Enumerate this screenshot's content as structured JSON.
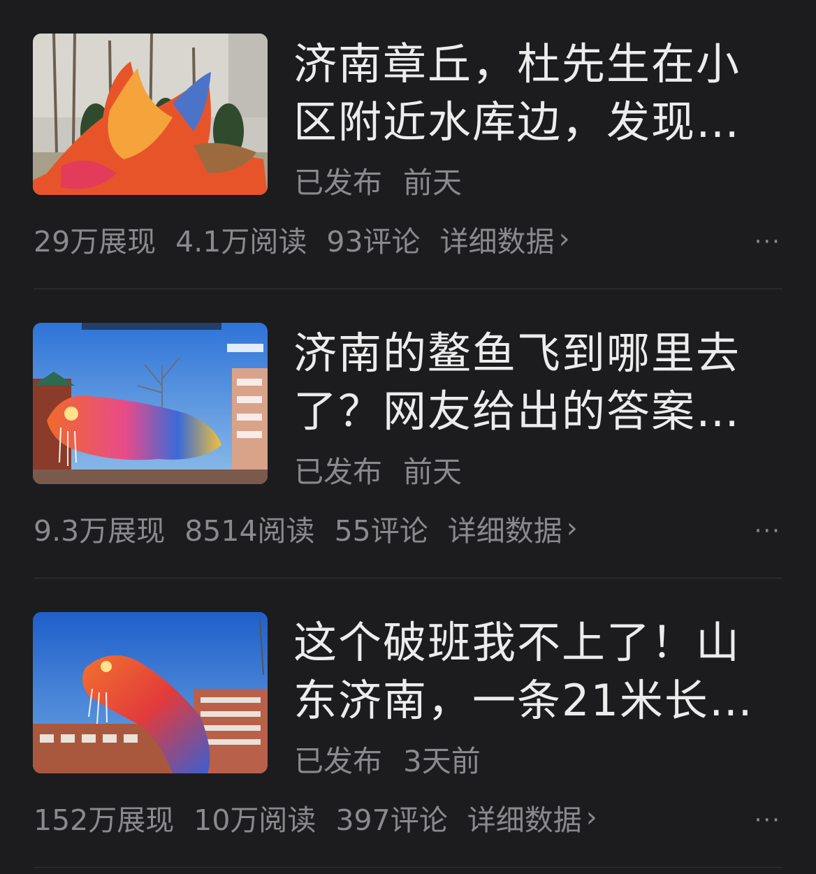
{
  "articles": [
    {
      "title_line1": "济南章丘，杜先生在小",
      "title_line2": "区附近水库边，发现…",
      "status": "已发布",
      "time": "前天",
      "impressions": "29万展现",
      "reads": "4.1万阅读",
      "comments": "93评论",
      "detail_label": "详细数据",
      "more_label": "···",
      "thumb_icon": "lantern-photo-thumbnail"
    },
    {
      "title_line1": "济南的鳌鱼飞到哪里去",
      "title_line2": "了？网友给出的答案…",
      "status": "已发布",
      "time": "前天",
      "impressions": "9.3万展现",
      "reads": "8514阅读",
      "comments": "55评论",
      "detail_label": "详细数据",
      "more_label": "···",
      "thumb_icon": "lantern-photo-thumbnail"
    },
    {
      "title_line1": "这个破班我不上了！山",
      "title_line2": "东济南，一条21米长…",
      "status": "已发布",
      "time": "3天前",
      "impressions": "152万展现",
      "reads": "10万阅读",
      "comments": "397评论",
      "detail_label": "详细数据",
      "more_label": "···",
      "thumb_icon": "lantern-photo-thumbnail"
    }
  ],
  "colors": {
    "background": "#1c1c1e",
    "title_text": "#ececec",
    "secondary_text": "#8a8a8e",
    "divider": "#333336"
  }
}
